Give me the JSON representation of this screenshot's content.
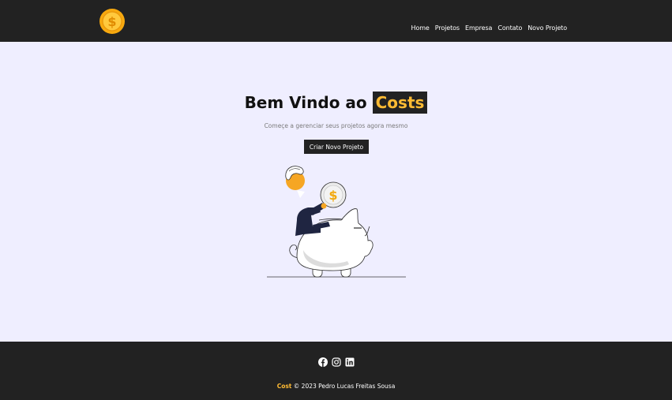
{
  "navbar": {
    "logo_icon": "coin-dollar-icon",
    "links": [
      "Home",
      "Projetos",
      "Empresa",
      "Contato",
      "Novo Projeto"
    ]
  },
  "hero": {
    "title_prefix": "Bem Vindo ao",
    "title_brand": "Costs",
    "subtitle": "Começe a gerenciar seus projetos agora mesmo",
    "button_label": "Criar Novo Projeto",
    "illustration": "piggy-bank-savings-illustration"
  },
  "footer": {
    "social_icons": [
      "facebook-icon",
      "instagram-icon",
      "linkedin-icon"
    ],
    "brand": "Cost",
    "copyright_text": "© 2023 Pedro Lucas Freitas Sousa"
  },
  "colors": {
    "navbar_bg": "#222222",
    "accent": "#ffbb33",
    "page_bg": "#efeeff",
    "text": "#111111"
  }
}
